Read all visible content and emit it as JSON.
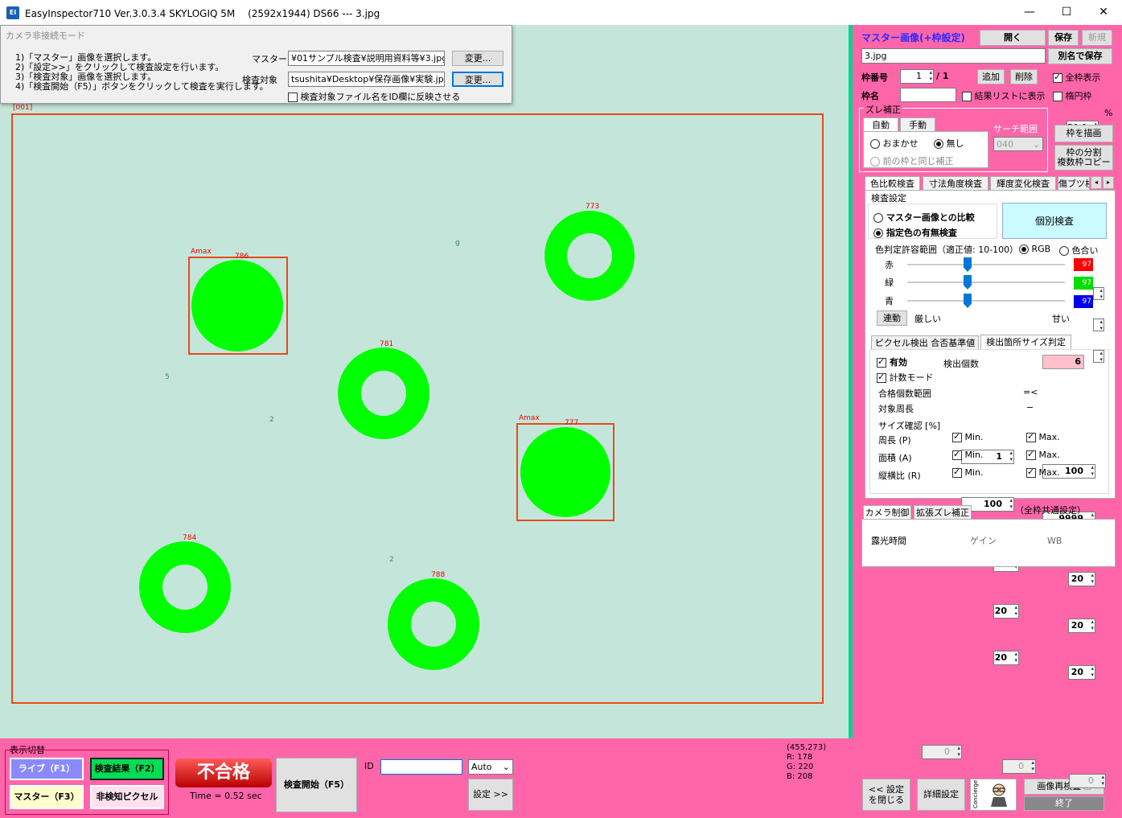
{
  "window": {
    "title": "EasyInspector710 Ver.3.0.3.4 SKYLOGIQ 5M　 (2592x1944) DS66 --- 3.jpg",
    "icon": "app-logo-icon",
    "min": "—",
    "max": "☐",
    "close": "✕"
  },
  "popup": {
    "mode": "カメラ非接続モード",
    "steps": "1)「マスター」画像を選択します。\n2)「設定>>」をクリックして検査設定を行います。\n3)「検査対象」画像を選択します。\n4)「検査開始（F5）」ボタンをクリックして検査を実行します。",
    "master_label": "マスター",
    "master_value": "¥01サンプル検査¥説明用資料等¥3.jpg",
    "target_label": "検査対象",
    "target_value": "tsushita¥Desktop¥保存画像¥実験.jpg",
    "change": "変更...",
    "reflect": "検査対象ファイル名をID欄に反映させる"
  },
  "image": {
    "frame_label": "[001]",
    "amax": "Amax",
    "labels": [
      "773",
      "786",
      "781",
      "777",
      "784",
      "788"
    ],
    "specks": [
      "g",
      "5",
      "2",
      "2"
    ]
  },
  "bottom": {
    "display_switch": "表示切替",
    "live": "ライブ（F1）",
    "result": "検査結果（F2）",
    "master": "マスター（F3）",
    "nondetect": "非検知ピクセル",
    "verdict": "不合格",
    "time": "Time = 0.52 sec",
    "start": "検査開始（F5）",
    "id_label": "ID",
    "id_value": "",
    "auto": "Auto",
    "settings": "設定 >>",
    "coords": "(455,273)",
    "r": "R: 178",
    "g": "G: 220",
    "b": "B: 208",
    "close_settings": "<< 設定\nを閉じる",
    "detail": "詳細設定",
    "concierge": "Concierge",
    "recheck": "画像再検査",
    "exit": "終了"
  },
  "right": {
    "master_title": "マスター画像(+枠設定)",
    "open": "開く",
    "save": "保存",
    "new": "新規",
    "master_file": "3.jpg",
    "save_as": "別名で保存",
    "frame_no_label": "枠番号",
    "frame_no": "1",
    "frame_total": "/ 1",
    "add": "追加",
    "delete": "削除",
    "show_all": "全枠表示",
    "frame_name_label": "枠名",
    "frame_name": "",
    "show_in_results": "結果リストに表示",
    "ellipse": "楕円枠",
    "shift_title": "ズレ補正",
    "auto_tab": "自動",
    "manual_tab": "手動",
    "omakase": "おまかせ",
    "none": "無し",
    "same_as_prev": "前の枠と同じ補正",
    "search_range": "サーチ範囲",
    "search_value": "040",
    "zoom": "50.0",
    "zoom_unit": "%",
    "draw_frame": "枠を描画",
    "split": "枠の分割\n複数枠コピー",
    "tabs": [
      "色比較検査",
      "寸法角度検査",
      "輝度変化検査",
      "傷ブツ検"
    ],
    "inspect_setting": "検査設定",
    "cmp_master": "マスター画像との比較",
    "color_presence": "指定色の有無検査",
    "individual": "個別検査",
    "tol_label": "色判定許容範囲（適正値: 10-100）",
    "rgb": "RGB",
    "hue": "色合い",
    "red": "赤",
    "green": "緑",
    "blue": "青",
    "red_v": "97",
    "green_v": "97",
    "blue_v": "97",
    "link": "連動",
    "strict": "厳しい",
    "lenient": "甘い",
    "subtab1": "ピクセル検出 合否基準値",
    "subtab2": "検出箇所サイズ判定",
    "valid": "有効",
    "detect_count_label": "検出個数",
    "detect_count": "6",
    "count_mode": "計数モード",
    "pass_range": "合格個数範囲",
    "pass_min": "1",
    "pass_sym": "=<",
    "pass_max": "100",
    "perim_label": "対象周長",
    "perim_min": "100",
    "perim_sym": "−",
    "perim_max": "9999",
    "size_confirm": "サイズ確認 [%]",
    "rows": [
      {
        "label": "周長 (P)",
        "min": "20",
        "max": "20"
      },
      {
        "label": "面積 (A)",
        "min": "20",
        "max": "20"
      },
      {
        "label": "縦横比 (R)",
        "min": "20",
        "max": "20"
      }
    ],
    "min": "Min.",
    "max": "Max.",
    "camera_tab": "カメラ制御",
    "ext_tab": "拡張ズレ補正",
    "common": "（全枠共通設定）",
    "exposure": "露光時間",
    "exposure_v": "0",
    "gain": "ゲイン",
    "gain_v": "0",
    "wb": "WB",
    "wb_v": "0"
  }
}
